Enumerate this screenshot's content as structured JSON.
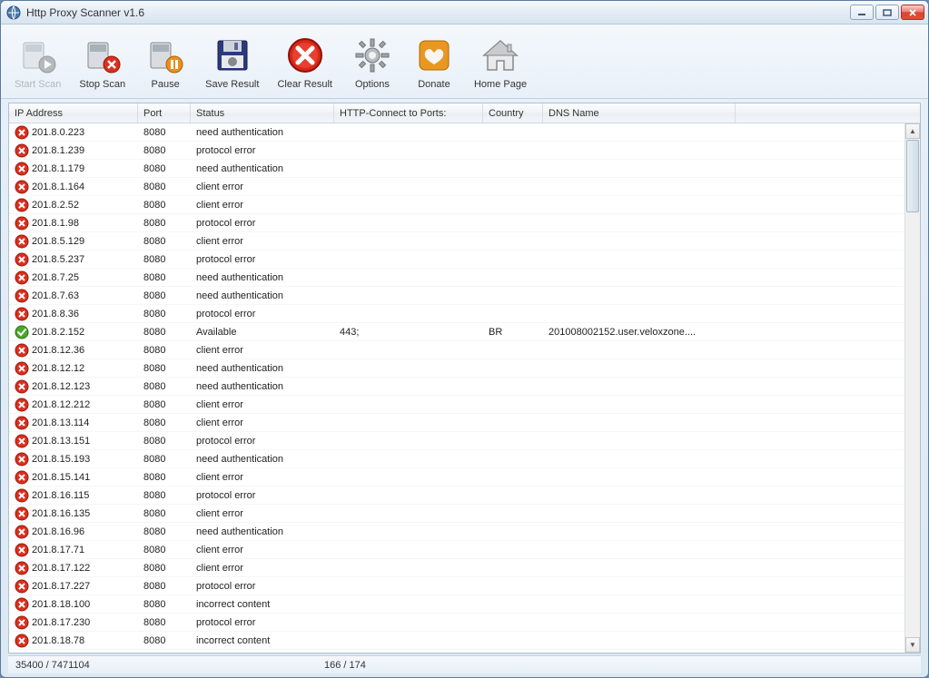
{
  "window": {
    "title": "Http Proxy Scanner v1.6"
  },
  "toolbar": [
    {
      "id": "start-scan",
      "label": "Start Scan",
      "disabled": true
    },
    {
      "id": "stop-scan",
      "label": "Stop Scan",
      "disabled": false
    },
    {
      "id": "pause",
      "label": "Pause",
      "disabled": false
    },
    {
      "id": "save-result",
      "label": "Save Result",
      "disabled": false
    },
    {
      "id": "clear-result",
      "label": "Clear Result",
      "disabled": false
    },
    {
      "id": "options",
      "label": "Options",
      "disabled": false
    },
    {
      "id": "donate",
      "label": "Donate",
      "disabled": false
    },
    {
      "id": "home-page",
      "label": "Home Page",
      "disabled": false
    }
  ],
  "columns": {
    "ip": "IP Address",
    "port": "Port",
    "status": "Status",
    "http": "HTTP-Connect to Ports:",
    "country": "Country",
    "dns": "DNS Name"
  },
  "rows": [
    {
      "ip": "201.8.0.223",
      "port": "8080",
      "status": "need authentication",
      "http": "",
      "country": "",
      "dns": "",
      "ok": false
    },
    {
      "ip": "201.8.1.239",
      "port": "8080",
      "status": "protocol error",
      "http": "",
      "country": "",
      "dns": "",
      "ok": false
    },
    {
      "ip": "201.8.1.179",
      "port": "8080",
      "status": "need authentication",
      "http": "",
      "country": "",
      "dns": "",
      "ok": false
    },
    {
      "ip": "201.8.1.164",
      "port": "8080",
      "status": "client error",
      "http": "",
      "country": "",
      "dns": "",
      "ok": false
    },
    {
      "ip": "201.8.2.52",
      "port": "8080",
      "status": "client error",
      "http": "",
      "country": "",
      "dns": "",
      "ok": false
    },
    {
      "ip": "201.8.1.98",
      "port": "8080",
      "status": "protocol error",
      "http": "",
      "country": "",
      "dns": "",
      "ok": false
    },
    {
      "ip": "201.8.5.129",
      "port": "8080",
      "status": "client error",
      "http": "",
      "country": "",
      "dns": "",
      "ok": false
    },
    {
      "ip": "201.8.5.237",
      "port": "8080",
      "status": "protocol error",
      "http": "",
      "country": "",
      "dns": "",
      "ok": false
    },
    {
      "ip": "201.8.7.25",
      "port": "8080",
      "status": "need authentication",
      "http": "",
      "country": "",
      "dns": "",
      "ok": false
    },
    {
      "ip": "201.8.7.63",
      "port": "8080",
      "status": "need authentication",
      "http": "",
      "country": "",
      "dns": "",
      "ok": false
    },
    {
      "ip": "201.8.8.36",
      "port": "8080",
      "status": "protocol error",
      "http": "",
      "country": "",
      "dns": "",
      "ok": false
    },
    {
      "ip": "201.8.2.152",
      "port": "8080",
      "status": "Available",
      "http": "443;",
      "country": "BR",
      "dns": "201008002152.user.veloxzone....",
      "ok": true
    },
    {
      "ip": "201.8.12.36",
      "port": "8080",
      "status": "client error",
      "http": "",
      "country": "",
      "dns": "",
      "ok": false
    },
    {
      "ip": "201.8.12.12",
      "port": "8080",
      "status": "need authentication",
      "http": "",
      "country": "",
      "dns": "",
      "ok": false
    },
    {
      "ip": "201.8.12.123",
      "port": "8080",
      "status": "need authentication",
      "http": "",
      "country": "",
      "dns": "",
      "ok": false
    },
    {
      "ip": "201.8.12.212",
      "port": "8080",
      "status": "client error",
      "http": "",
      "country": "",
      "dns": "",
      "ok": false
    },
    {
      "ip": "201.8.13.114",
      "port": "8080",
      "status": "client error",
      "http": "",
      "country": "",
      "dns": "",
      "ok": false
    },
    {
      "ip": "201.8.13.151",
      "port": "8080",
      "status": "protocol error",
      "http": "",
      "country": "",
      "dns": "",
      "ok": false
    },
    {
      "ip": "201.8.15.193",
      "port": "8080",
      "status": "need authentication",
      "http": "",
      "country": "",
      "dns": "",
      "ok": false
    },
    {
      "ip": "201.8.15.141",
      "port": "8080",
      "status": "client error",
      "http": "",
      "country": "",
      "dns": "",
      "ok": false
    },
    {
      "ip": "201.8.16.115",
      "port": "8080",
      "status": "protocol error",
      "http": "",
      "country": "",
      "dns": "",
      "ok": false
    },
    {
      "ip": "201.8.16.135",
      "port": "8080",
      "status": "client error",
      "http": "",
      "country": "",
      "dns": "",
      "ok": false
    },
    {
      "ip": "201.8.16.96",
      "port": "8080",
      "status": "need authentication",
      "http": "",
      "country": "",
      "dns": "",
      "ok": false
    },
    {
      "ip": "201.8.17.71",
      "port": "8080",
      "status": "client error",
      "http": "",
      "country": "",
      "dns": "",
      "ok": false
    },
    {
      "ip": "201.8.17.122",
      "port": "8080",
      "status": "client error",
      "http": "",
      "country": "",
      "dns": "",
      "ok": false
    },
    {
      "ip": "201.8.17.227",
      "port": "8080",
      "status": "protocol error",
      "http": "",
      "country": "",
      "dns": "",
      "ok": false
    },
    {
      "ip": "201.8.18.100",
      "port": "8080",
      "status": "incorrect content",
      "http": "",
      "country": "",
      "dns": "",
      "ok": false
    },
    {
      "ip": "201.8.17.230",
      "port": "8080",
      "status": "protocol error",
      "http": "",
      "country": "",
      "dns": "",
      "ok": false
    },
    {
      "ip": "201.8.18.78",
      "port": "8080",
      "status": "incorrect content",
      "http": "",
      "country": "",
      "dns": "",
      "ok": false
    }
  ],
  "statusbar": {
    "left": "35400 / 7471104",
    "right": "166 / 174"
  }
}
